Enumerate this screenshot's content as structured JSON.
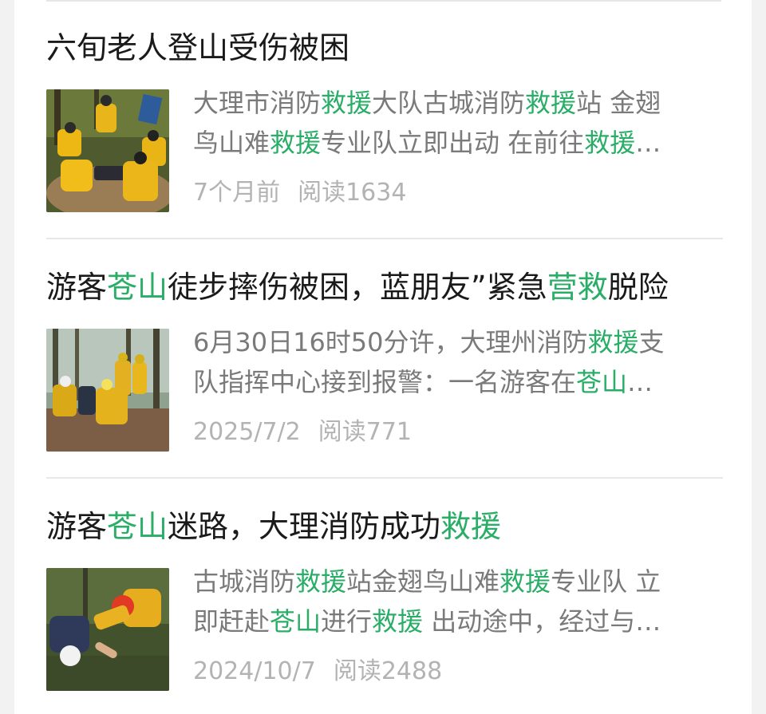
{
  "colors": {
    "highlight": "#2aae67",
    "title": "#1a1a1a",
    "summary": "#7a7a7a",
    "meta": "#b3b3b3"
  },
  "articles": [
    {
      "title": [
        {
          "t": "六旬老人登山受伤被困"
        }
      ],
      "summary_line1": [
        {
          "t": "大理市消防"
        },
        {
          "t": "救援",
          "hl": true
        },
        {
          "t": "大队古城消防"
        },
        {
          "t": "救援",
          "hl": true
        },
        {
          "t": "站 金翅"
        }
      ],
      "summary_line2": [
        {
          "t": "鸟山难"
        },
        {
          "t": "救援",
          "hl": true
        },
        {
          "t": "专业队立即出动 在前往"
        },
        {
          "t": "救援",
          "hl": true
        },
        {
          "t": "…"
        }
      ],
      "time": "7个月前",
      "reads": "阅读1634",
      "thumbnail_icon": "rescue-team-forest-photo"
    },
    {
      "title": [
        {
          "t": "游客"
        },
        {
          "t": "苍山",
          "hl": true
        },
        {
          "t": "徒步摔伤被困，蓝朋友”紧急"
        },
        {
          "t": "营救",
          "hl": true
        },
        {
          "t": "脱险"
        }
      ],
      "summary_line1": [
        {
          "t": "6月30日16时50分许，大理州消防"
        },
        {
          "t": "救援",
          "hl": true
        },
        {
          "t": "支"
        }
      ],
      "summary_line2": [
        {
          "t": "队指挥中心接到报警：一名游客在"
        },
        {
          "t": "苍山",
          "hl": true
        },
        {
          "t": "…"
        }
      ],
      "time": "2025/7/2",
      "reads": "阅读771",
      "thumbnail_icon": "rescue-team-woods-photo"
    },
    {
      "title": [
        {
          "t": "游客"
        },
        {
          "t": "苍山",
          "hl": true
        },
        {
          "t": "迷路，大理消防成功"
        },
        {
          "t": "救援",
          "hl": true
        }
      ],
      "summary_line1": [
        {
          "t": "古城消防"
        },
        {
          "t": "救援",
          "hl": true
        },
        {
          "t": "站金翅鸟山难"
        },
        {
          "t": "救援",
          "hl": true
        },
        {
          "t": "专业队 立"
        }
      ],
      "summary_line2": [
        {
          "t": "即赶赴"
        },
        {
          "t": "苍山",
          "hl": true
        },
        {
          "t": "进行"
        },
        {
          "t": "救援",
          "hl": true
        },
        {
          "t": " 出动途中，经过与…"
        }
      ],
      "time": "2024/10/7",
      "reads": "阅读2488",
      "thumbnail_icon": "rescuer-helping-hiker-photo"
    }
  ]
}
